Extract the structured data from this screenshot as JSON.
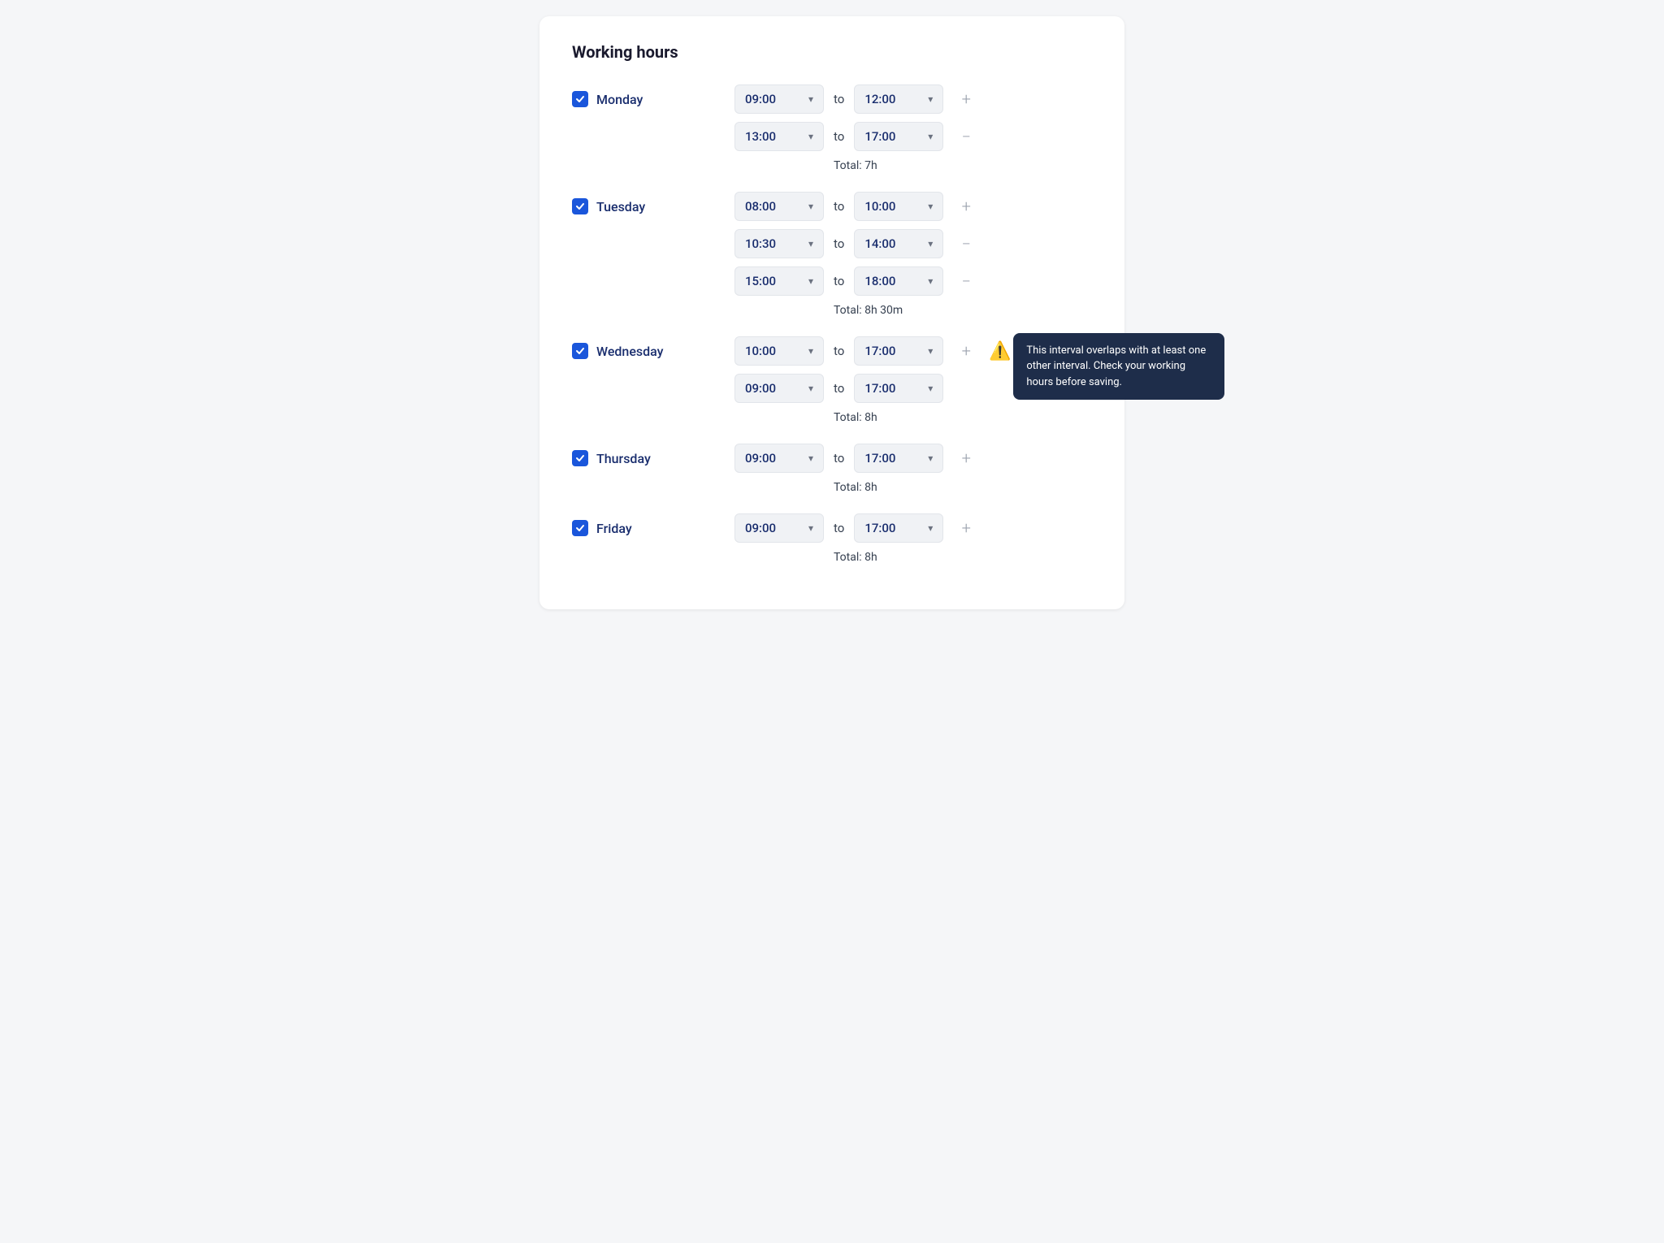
{
  "title": "Working hours",
  "days": [
    {
      "name": "Monday",
      "checked": true,
      "intervals": [
        {
          "from": "09:00",
          "to": "12:00",
          "action": "add"
        },
        {
          "from": "13:00",
          "to": "17:00",
          "action": "remove"
        }
      ],
      "total": "Total: 7h"
    },
    {
      "name": "Tuesday",
      "checked": true,
      "intervals": [
        {
          "from": "08:00",
          "to": "10:00",
          "action": "add"
        },
        {
          "from": "10:30",
          "to": "14:00",
          "action": "remove"
        },
        {
          "from": "15:00",
          "to": "18:00",
          "action": "remove"
        }
      ],
      "total": "Total: 8h 30m"
    },
    {
      "name": "Wednesday",
      "checked": true,
      "intervals": [
        {
          "from": "10:00",
          "to": "17:00",
          "action": "add",
          "warning": true
        },
        {
          "from": "09:00",
          "to": "17:00",
          "action": null
        }
      ],
      "total": "Total: 8h",
      "tooltip": "This interval overlaps with at least one other interval. Check your working hours before saving."
    },
    {
      "name": "Thursday",
      "checked": true,
      "intervals": [
        {
          "from": "09:00",
          "to": "17:00",
          "action": "add"
        }
      ],
      "total": "Total: 8h"
    },
    {
      "name": "Friday",
      "checked": true,
      "intervals": [
        {
          "from": "09:00",
          "to": "17:00",
          "action": "add"
        }
      ],
      "total": "Total: 8h"
    }
  ],
  "labels": {
    "to": "to",
    "add": "+",
    "remove": "−"
  }
}
